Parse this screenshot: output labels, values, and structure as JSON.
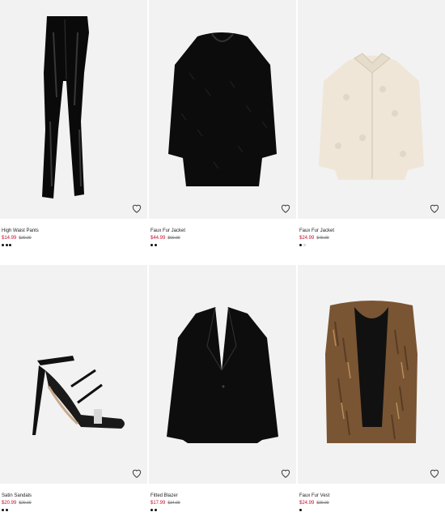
{
  "products": [
    {
      "name": "High Waist Pants",
      "price": "$14.99",
      "original_price": "$29.99",
      "swatches": [
        "#111111",
        "#111111",
        "#111111"
      ],
      "image": "vinyl-pants"
    },
    {
      "name": "Faux Fur Jacket",
      "price": "$44.99",
      "original_price": "$69.99",
      "swatches": [
        "#111111",
        "#111111"
      ],
      "image": "black-fur-jacket"
    },
    {
      "name": "Faux Fur Jacket",
      "price": "$24.99",
      "original_price": "$49.99",
      "swatches": [
        "#111111",
        "#d9d4cc"
      ],
      "image": "cream-teddy-jacket"
    },
    {
      "name": "Satin Sandals",
      "price": "$20.99",
      "original_price": "$29.99",
      "swatches": [
        "#111111",
        "#111111"
      ],
      "image": "satin-sandals"
    },
    {
      "name": "Fitted Blazer",
      "price": "$17.99",
      "original_price": "$34.99",
      "swatches": [
        "#111111",
        "#111111"
      ],
      "image": "black-blazer"
    },
    {
      "name": "Faux Fur Vest",
      "price": "$24.99",
      "original_price": "$39.99",
      "swatches": [
        "#111111"
      ],
      "image": "faux-fur-vest"
    }
  ],
  "icons": {
    "favorite": "heart-icon"
  },
  "colors": {
    "sale": "#c8102e",
    "background": "#f2f2f2"
  }
}
